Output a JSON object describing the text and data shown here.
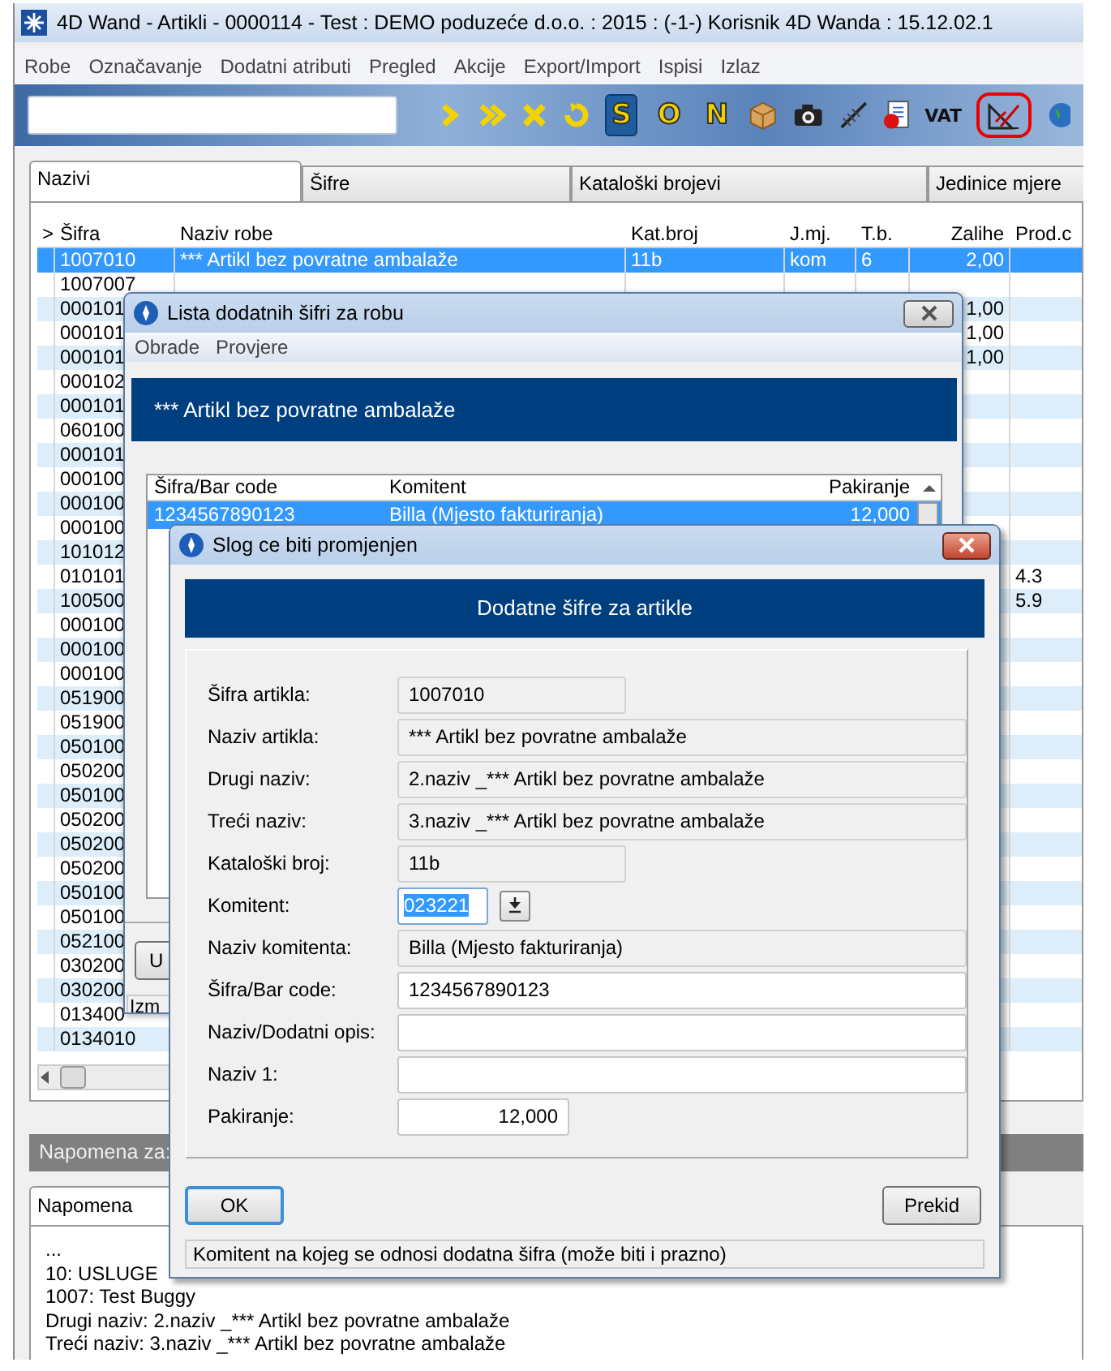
{
  "window": {
    "title": "4D Wand - Artikli - 0000114 - Test : DEMO poduzeće d.o.o. : 2015 : (-1-) Korisnik 4D Wanda : 15.12.02.1"
  },
  "menu": [
    "Robe",
    "Označavanje",
    "Dodatni atributi",
    "Pregled",
    "Akcije",
    "Export/Import",
    "Ispisi",
    "Izlaz"
  ],
  "toolbar": {
    "letter_buttons": [
      {
        "label": "S",
        "selected": true
      },
      {
        "label": "O",
        "selected": false
      },
      {
        "label": "N",
        "selected": false
      }
    ],
    "vat_label": "VAT"
  },
  "tabs": [
    {
      "label": "Nazivi",
      "selected": true
    },
    {
      "label": "Šifre",
      "selected": false
    },
    {
      "label": "Kataloški brojevi",
      "selected": false
    },
    {
      "label": "Jedinice mjere",
      "selected": false
    }
  ],
  "table": {
    "columns": [
      ">",
      "Šifra",
      "Naziv robe",
      "Kat.broj",
      "J.mj.",
      "T.b.",
      "Zalihe",
      "Prod.c"
    ],
    "rows": [
      {
        "code": "1007010",
        "name": "*** Artikl bez povratne ambalaže",
        "cat_no": "11b",
        "unit": "kom",
        "tb": "6",
        "stock": "2,00",
        "selected": true
      },
      {
        "code": "1007007",
        "selected": false
      },
      {
        "code": "000101",
        "stock": "1,00",
        "selected": false
      },
      {
        "code": "000101",
        "stock": "1,00",
        "selected": false
      },
      {
        "code": "000101",
        "stock": "1,00",
        "selected": false
      },
      {
        "code": "000102",
        "selected": false
      },
      {
        "code": "000101",
        "selected": false
      },
      {
        "code": "060100",
        "selected": false
      },
      {
        "code": "000101",
        "selected": false
      },
      {
        "code": "000100",
        "selected": false
      },
      {
        "code": "000100",
        "selected": false
      },
      {
        "code": "000100",
        "selected": false
      },
      {
        "code": "101012",
        "selected": false
      },
      {
        "code": "010101",
        "price": "4.3",
        "selected": false
      },
      {
        "code": "100500",
        "price": "5.9",
        "selected": false
      },
      {
        "code": "000100",
        "selected": false
      },
      {
        "code": "000100",
        "selected": false
      },
      {
        "code": "000100",
        "selected": false
      },
      {
        "code": "051900",
        "selected": false
      },
      {
        "code": "051900",
        "selected": false
      },
      {
        "code": "050100",
        "selected": false
      },
      {
        "code": "050200",
        "selected": false
      },
      {
        "code": "050100",
        "selected": false
      },
      {
        "code": "050200",
        "selected": false
      },
      {
        "code": "050200",
        "selected": false
      },
      {
        "code": "050200",
        "selected": false
      },
      {
        "code": "050100",
        "selected": false
      },
      {
        "code": "050100",
        "selected": false
      },
      {
        "code": "052100",
        "selected": false
      },
      {
        "code": "030200",
        "selected": false
      },
      {
        "code": "030200",
        "selected": false
      },
      {
        "code": "013400",
        "selected": false
      },
      {
        "code": "0134010",
        "selected": false
      }
    ]
  },
  "note_bar": {
    "label": "Napomena za:"
  },
  "note_tabs": [
    {
      "label": "Napomena",
      "selected": true
    }
  ],
  "note_lines": [
    "...",
    "10: USLUGE",
    "1007: Test Buggy",
    "Drugi naziv: 2.naziv _*** Artikl bez povratne ambalaže",
    "Treći naziv: 3.naziv _*** Artikl bez povratne ambalaže"
  ],
  "codes_dialog": {
    "title": "Lista dodatnih šifri za robu",
    "menu": [
      "Obrade",
      "Provjere"
    ],
    "header": "*** Artikl bez povratne ambalaže",
    "list": {
      "columns": [
        "Šifra/Bar code",
        "Komitent",
        "Pakiranje"
      ],
      "rows": [
        {
          "code": "1234567890123",
          "partner": "Billa (Mjesto fakturiranja)",
          "packing": "12,000",
          "selected": true
        }
      ]
    },
    "button": "U",
    "status": "Izm"
  },
  "edit_dialog": {
    "title": "Slog ce biti promjenjen",
    "header": "Dodatne šifre za artikle",
    "fields": [
      {
        "label": "Šifra artikla:",
        "value": "1007010",
        "kind": "short",
        "editable": false
      },
      {
        "label": "Naziv artikla:",
        "value": "*** Artikl bez povratne ambalaže",
        "kind": "wide",
        "editable": false
      },
      {
        "label": "Drugi naziv:",
        "value": "2.naziv _*** Artikl bez povratne ambalaže",
        "kind": "wide",
        "editable": false
      },
      {
        "label": "Treći naziv:",
        "value": "3.naziv _*** Artikl bez povratne ambalaže",
        "kind": "wide",
        "editable": false
      },
      {
        "label": "Kataloški broj:",
        "value": "11b",
        "kind": "short",
        "editable": false
      },
      {
        "label": "Komitent:",
        "value": "023221",
        "kind": "lookup",
        "editable": true
      },
      {
        "label": "Naziv komitenta:",
        "value": "Billa (Mjesto fakturiranja)",
        "kind": "wide",
        "editable": false
      },
      {
        "label": "Šifra/Bar code:",
        "value": "1234567890123",
        "kind": "wide",
        "editable": true
      },
      {
        "label": "Naziv/Dodatni opis:",
        "kind": "wide",
        "editable": true
      },
      {
        "label": "Naziv 1:",
        "kind": "wide",
        "editable": true
      },
      {
        "label": "Pakiranje:",
        "value": "12,000",
        "kind": "number",
        "editable": true
      }
    ],
    "buttons": [
      {
        "label": "OK",
        "focused": true
      },
      {
        "label": "Prekid",
        "focused": false
      }
    ],
    "status": "Komitent na kojeg se odnosi dodatna šifra (može biti i prazno)"
  }
}
